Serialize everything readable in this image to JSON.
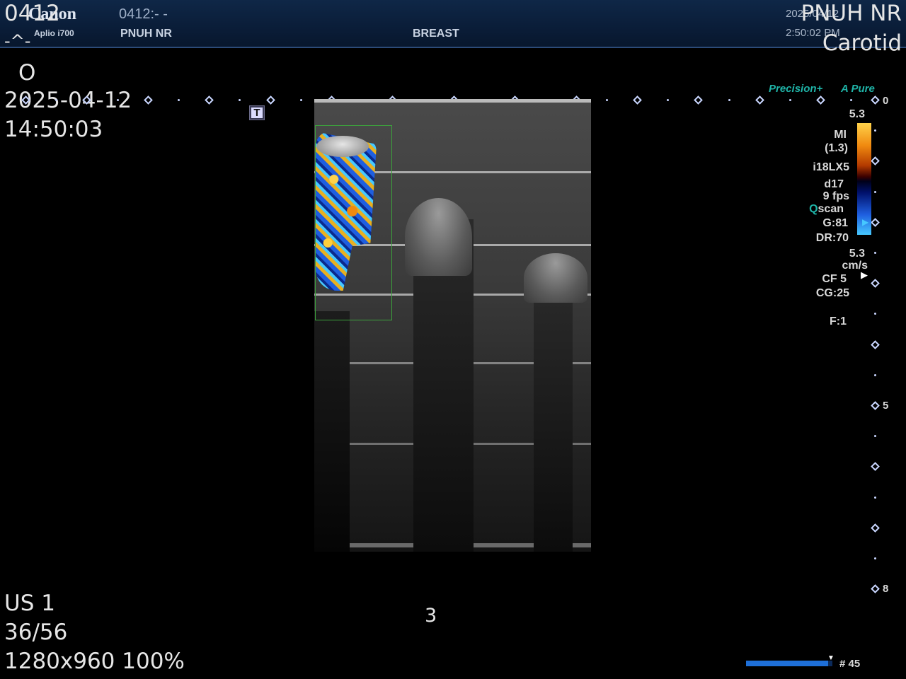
{
  "header": {
    "brand": "Canon",
    "model": "Aplio i700",
    "patient_id": "0412:- -",
    "institution": "PNUH NR",
    "exam": "BREAST",
    "date_short": "2025/04/12",
    "time": "2:50:02 PM"
  },
  "viewer_overlay": {
    "patient_id": "0412",
    "patient_sub": "-^-",
    "orientation_marker": "O",
    "date": "2025-04-12",
    "time": "14:50:03",
    "institution": "PNUH NR",
    "body_part": "Carotid",
    "modality": "US 1",
    "image_index": "36/56",
    "resolution": "1280x960 100%",
    "frame_number": "3"
  },
  "precision_logo": "Precision+",
  "pure_logo": "A Pure",
  "t_marker": "T",
  "scale": {
    "labels": [
      "0",
      "5",
      "8"
    ]
  },
  "params": {
    "max_velocity": "5.3",
    "mi_label": "MI",
    "mi_value": "(1.3)",
    "probe": "i18LX5",
    "depth": "d17",
    "fps": "9 fps",
    "qscan": "Qscan",
    "gain": "G:81",
    "dynamic_range": "DR:70",
    "velocity_value": "5.3",
    "velocity_unit": "cm/s",
    "color_frequency": "CF 5",
    "color_gain": "CG:25",
    "focus": "F:1"
  },
  "cine": {
    "frame_label": "# 45",
    "progress_fraction": 0.95
  },
  "colors": {
    "header_bg": "#0f2747",
    "accent_teal": "#1fb4a8",
    "scale_tick": "#c9d6ff",
    "roi_box": "#3ca23c",
    "cine_bar": "#1e6fd8"
  }
}
